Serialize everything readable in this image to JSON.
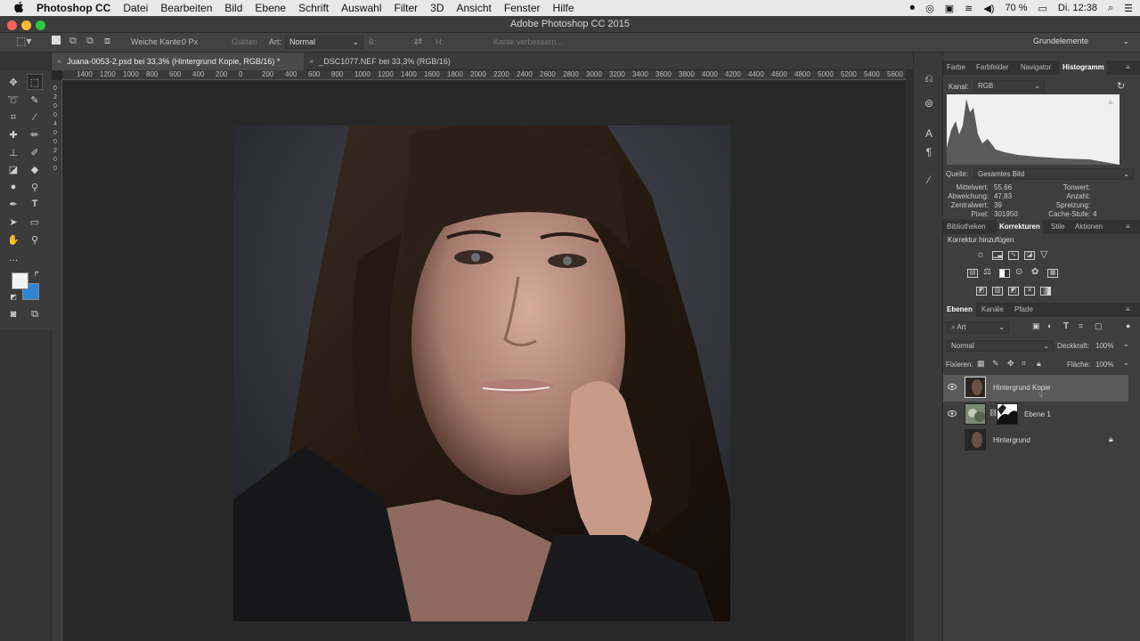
{
  "menubar": {
    "apple": "",
    "app_name": "Photoshop CC",
    "items": [
      "Datei",
      "Bearbeiten",
      "Bild",
      "Ebene",
      "Schrift",
      "Auswahl",
      "Filter",
      "3D",
      "Ansicht",
      "Fenster",
      "Hilfe"
    ],
    "battery": "70 %",
    "clock": "Di. 12:38"
  },
  "window": {
    "title": "Adobe Photoshop CC 2015"
  },
  "options": {
    "feather_label": "Weiche Kante:",
    "feather_value": "0 Px",
    "antialias": "Glätten",
    "style_label": "Art:",
    "style_value": "Normal",
    "width_label": "B:",
    "height_label": "H:",
    "refine_edge": "Kante verbessern...",
    "workspace": "Grundelemente"
  },
  "tabs": [
    {
      "label": "Juana-0053-2.psd bei 33,3% (Hintergrund Kopie, RGB/16) *",
      "active": true
    },
    {
      "label": "_DSC1077.NEF bei 33,3% (RGB/16)",
      "active": false
    }
  ],
  "ruler_h": [
    "1400",
    "1200",
    "1000",
    "800",
    "600",
    "400",
    "200",
    "0",
    "200",
    "400",
    "600",
    "800",
    "1000",
    "1200",
    "1400",
    "1600",
    "1800",
    "2000",
    "2200",
    "2400",
    "2600",
    "2800",
    "3000",
    "3200",
    "3400",
    "3600",
    "3800",
    "4000",
    "4200",
    "4400",
    "4600",
    "4800",
    "5000",
    "5200",
    "5400",
    "5600",
    "5800"
  ],
  "ruler_v": [
    "0",
    "2",
    "0",
    "0",
    "4",
    "0",
    "0",
    "2",
    "0",
    "0"
  ],
  "panel_top": {
    "tabs": [
      "Farbe",
      "Farbfelder",
      "Navigator",
      "Histogramm"
    ],
    "active_tab": "Histogramm",
    "channel_label": "Kanal:",
    "channel_value": "RGB",
    "source_label": "Quelle:",
    "source_value": "Gesamtes Bild",
    "stats_left": [
      {
        "label": "Mittelwert:",
        "value": "55,66"
      },
      {
        "label": "Abweichung:",
        "value": "47,83"
      },
      {
        "label": "Zentralwert:",
        "value": "39"
      },
      {
        "label": "Pixel:",
        "value": "301950"
      }
    ],
    "stats_right": [
      {
        "label": "Tonwert:",
        "value": ""
      },
      {
        "label": "Anzahl:",
        "value": ""
      },
      {
        "label": "Spreizung:",
        "value": ""
      },
      {
        "label": "Cache-Stufe:",
        "value": "4"
      }
    ]
  },
  "panel_mid": {
    "tabs": [
      "Bibliotheken",
      "Korrekturen",
      "Stile",
      "Aktionen"
    ],
    "active_tab": "Korrekturen",
    "heading": "Korrektur hinzufügen"
  },
  "panel_layers": {
    "tabs": [
      "Ebenen",
      "Kanäle",
      "Pfade"
    ],
    "active_tab": "Ebenen",
    "filter_value": "Art",
    "blend_mode": "Normal",
    "opacity_label": "Deckkraft:",
    "opacity_value": "100%",
    "lock_label": "Fixieren:",
    "fill_label": "Fläche:",
    "fill_value": "100%",
    "layers": [
      {
        "name": "Hintergrund Kopie",
        "selected": true
      },
      {
        "name": "Ebene 1",
        "selected": false
      },
      {
        "name": "Hintergrund",
        "selected": false
      }
    ]
  },
  "colors": {
    "accent": "#2f86d6",
    "panel_bg": "#3e3e3e",
    "canvas_bg": "#282828"
  }
}
